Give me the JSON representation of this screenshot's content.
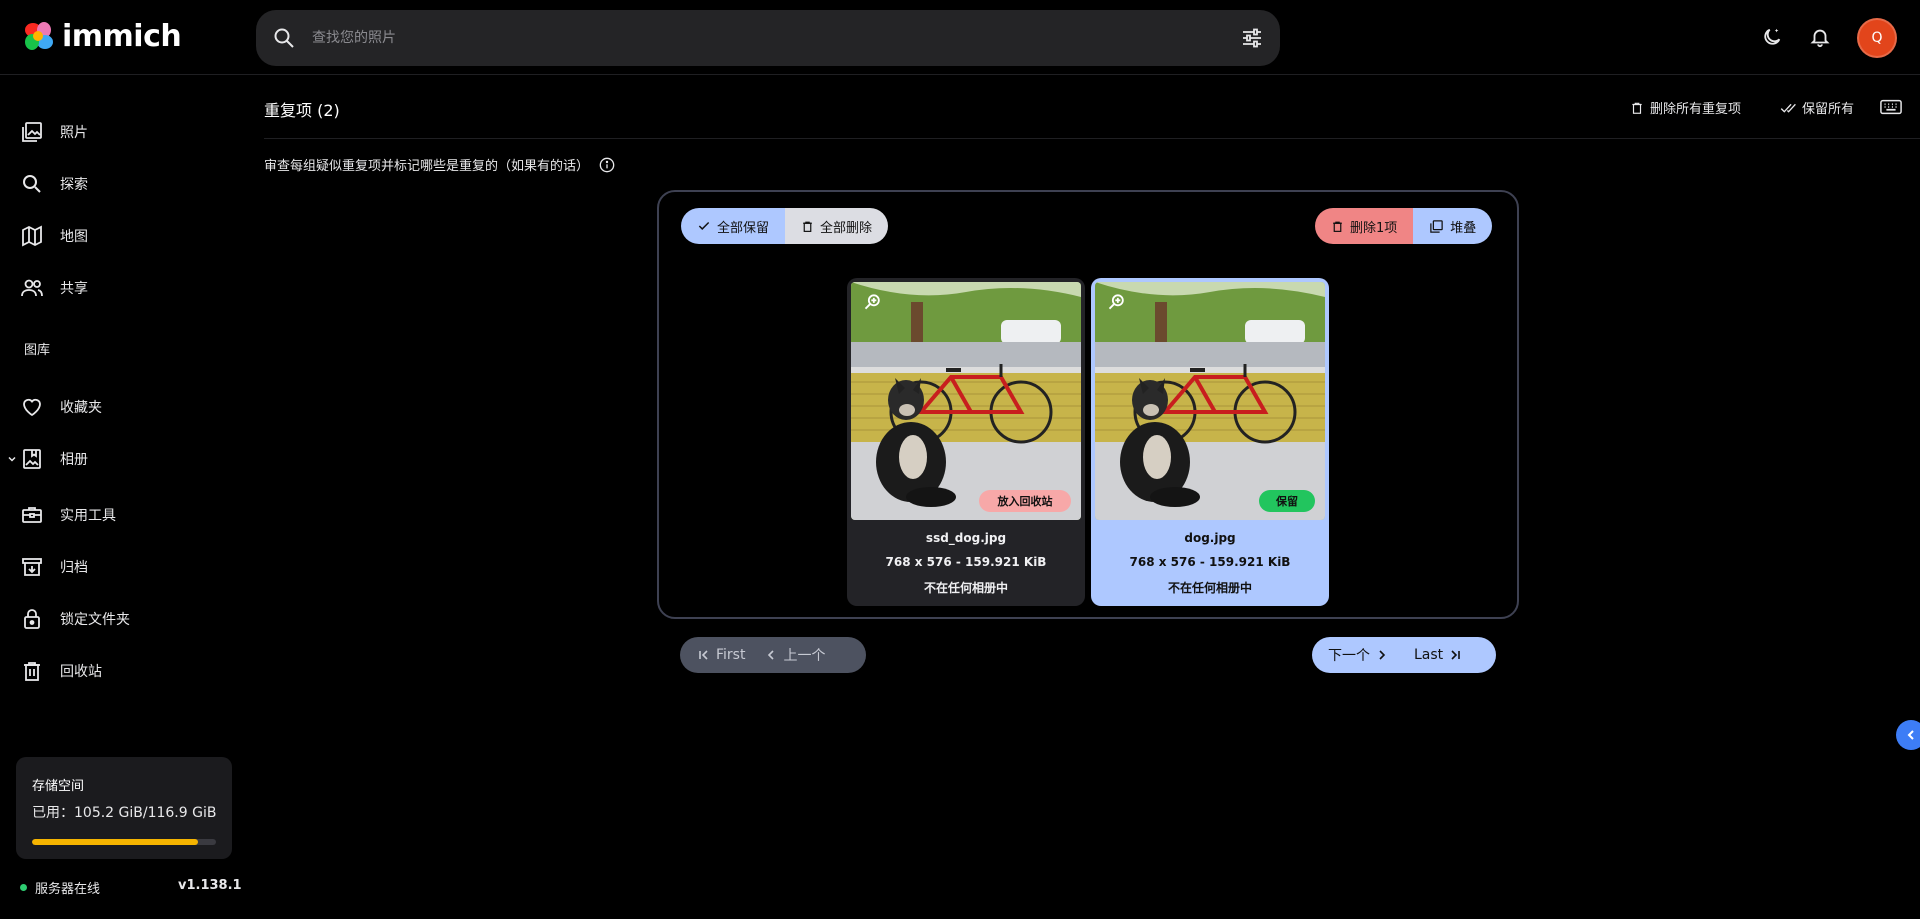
{
  "app": {
    "brand": "immich",
    "search_placeholder": "查找您的照片",
    "avatar_initial": "Q"
  },
  "sidebar": {
    "items": [
      {
        "label": "照片",
        "icon": "photos-icon"
      },
      {
        "label": "探索",
        "icon": "search-icon"
      },
      {
        "label": "地图",
        "icon": "map-icon"
      },
      {
        "label": "共享",
        "icon": "people-icon"
      }
    ],
    "library_label": "图库",
    "library_items": [
      {
        "label": "收藏夹",
        "icon": "heart-icon"
      },
      {
        "label": "相册",
        "icon": "album-icon"
      },
      {
        "label": "实用工具",
        "icon": "toolbox-icon"
      },
      {
        "label": "归档",
        "icon": "archive-icon"
      },
      {
        "label": "锁定文件夹",
        "icon": "lock-icon"
      },
      {
        "label": "回收站",
        "icon": "trash-icon"
      }
    ],
    "storage": {
      "title": "存储空间",
      "used_text": "已用：105.2 GiB/116.9 GiB",
      "used_fraction": 0.9,
      "bar_color": "#f5b400"
    },
    "server_status": "服务器在线",
    "version": "v1.138.1"
  },
  "main": {
    "title": "重复项 (2)",
    "delete_all_duplicates": "删除所有重复项",
    "keep_all": "保留所有",
    "description": "审查每组疑似重复项并标记哪些是重复的（如果有的话）",
    "group": {
      "keep_all_label": "全部保留",
      "trash_all_label": "全部删除",
      "delete_one_label": "删除1项",
      "stack_label": "堆叠",
      "assets": [
        {
          "filename": "ssd_dog.jpg",
          "size": "768 x 576 - 159.921 KiB",
          "albums": "不在任何相册中",
          "status": "放入回收站",
          "status_color": "#f7a8a8"
        },
        {
          "filename": "dog.jpg",
          "size": "768 x 576 - 159.921 KiB",
          "albums": "不在任何相册中",
          "status": "保留",
          "status_color": "#22c55e"
        }
      ]
    },
    "pager": {
      "first": "First",
      "prev": "上一个",
      "next": "下一个",
      "last": "Last"
    }
  },
  "colors": {
    "accent": "#aec8ff",
    "danger": "#f08585",
    "avatar": "#e2451b"
  }
}
